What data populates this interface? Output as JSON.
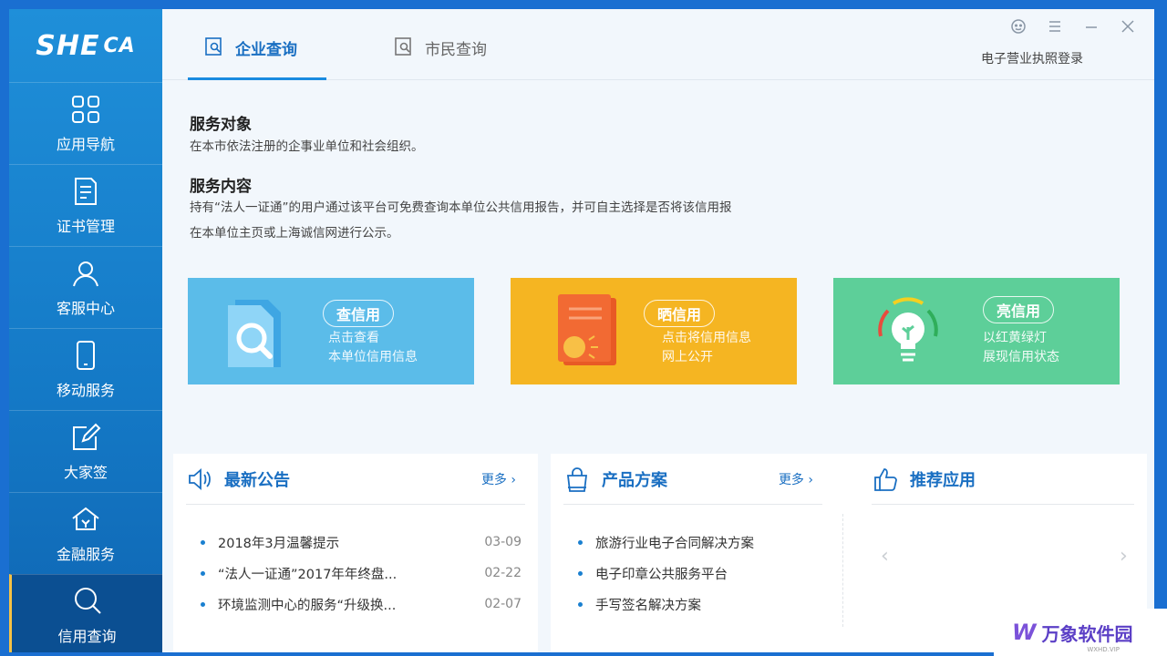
{
  "app": {
    "logo": {
      "main": "SHE",
      "sub": "CA"
    }
  },
  "sidebar": {
    "items": [
      {
        "label": "应用导航",
        "icon": "grid-icon"
      },
      {
        "label": "证书管理",
        "icon": "certificate-icon"
      },
      {
        "label": "客服中心",
        "icon": "user-icon"
      },
      {
        "label": "移动服务",
        "icon": "phone-icon"
      },
      {
        "label": "大家签",
        "icon": "edit-icon"
      },
      {
        "label": "金融服务",
        "icon": "bank-icon"
      },
      {
        "label": "信用查询",
        "icon": "search-icon",
        "active": true
      }
    ]
  },
  "header": {
    "tabs": [
      {
        "label": "企业查询",
        "active": true
      },
      {
        "label": "市民查询",
        "active": false
      }
    ],
    "license_login": "电子营业执照登录"
  },
  "content": {
    "service_target_title": "服务对象",
    "service_target_text": "在本市依法注册的企事业单位和社会组织。",
    "service_content_title": "服务内容",
    "service_content_text_1": "持有“法人一证通”的用户通过该平台可免费查询本单位公共信用报告，并可自主选择是否将该信用报",
    "service_content_text_2": "在本单位主页或上海诚信网进行公示。"
  },
  "cards": [
    {
      "title": "查信用",
      "desc_1": "点击查看",
      "desc_2": "本单位信用信息",
      "color": "#5bbce9"
    },
    {
      "title": "晒信用",
      "desc_1": "点击将信用信息",
      "desc_2": "网上公开",
      "color": "#f5b522"
    },
    {
      "title": "亮信用",
      "desc_1": "以红黄绿灯",
      "desc_2": "展现信用状态",
      "color": "#5dcf99"
    }
  ],
  "announcements": {
    "title": "最新公告",
    "more": "更多",
    "items": [
      {
        "text": "2018年3月温馨提示",
        "date": "03-09"
      },
      {
        "text": "“法人一证通”2017年年终盘...",
        "date": "02-22"
      },
      {
        "text": "环境监测中心的服务“升级换...",
        "date": "02-07"
      }
    ]
  },
  "solutions": {
    "title": "产品方案",
    "more": "更多",
    "items": [
      {
        "text": "旅游行业电子合同解决方案"
      },
      {
        "text": "电子印章公共服务平台"
      },
      {
        "text": "手写签名解决方案"
      }
    ]
  },
  "recommend": {
    "title": "推荐应用"
  },
  "watermark": {
    "logo": "W",
    "text": "万象软件园",
    "sub": "WXHD.VIP"
  }
}
